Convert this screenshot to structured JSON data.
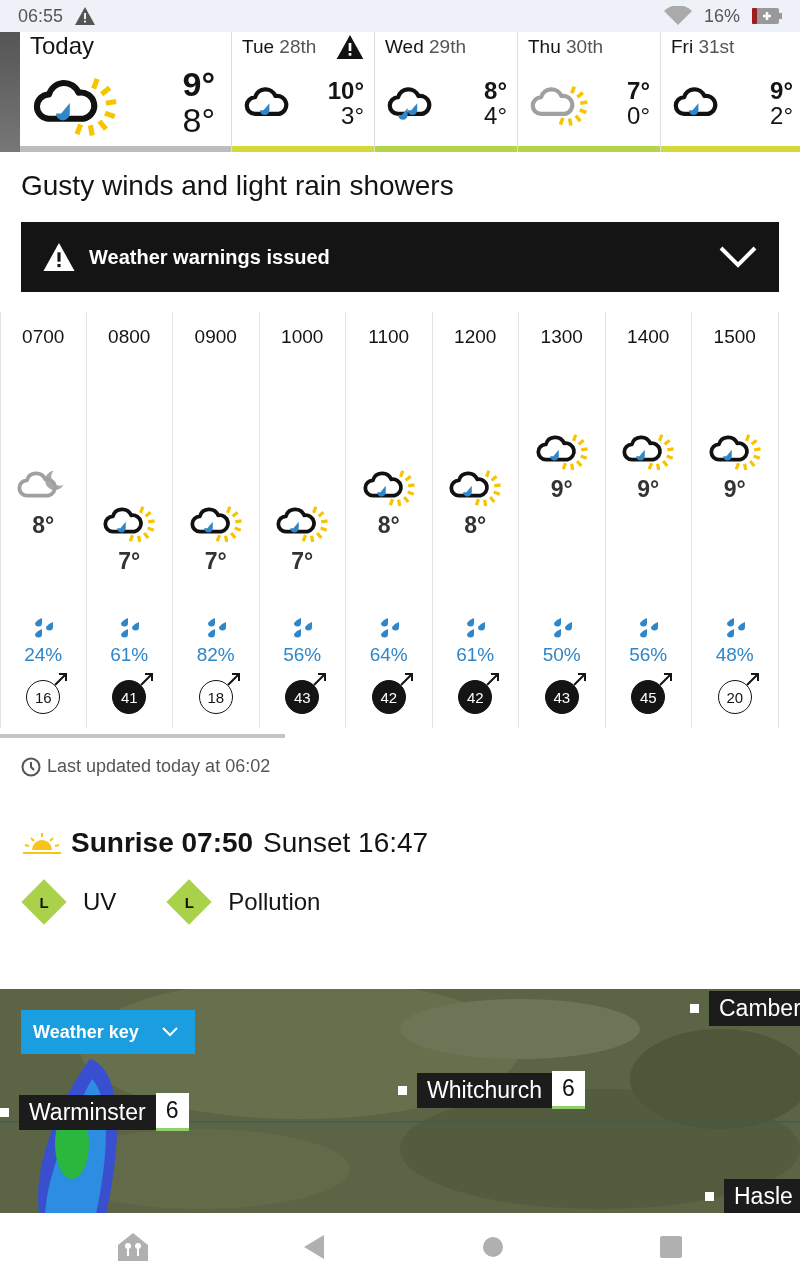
{
  "status_bar": {
    "time": "06:55",
    "battery": "16%"
  },
  "days": [
    {
      "label": "Today",
      "selected": true,
      "kind": "sun-shower",
      "high": "9°",
      "low": "8°",
      "warning": false,
      "color": "#bdbdbd"
    },
    {
      "day": "Tue",
      "date": "28th",
      "selected": false,
      "kind": "light-rain",
      "high": "10°",
      "low": "3°",
      "warning": true,
      "color": "#d4d93a"
    },
    {
      "day": "Wed",
      "date": "29th",
      "selected": false,
      "kind": "rain",
      "high": "8°",
      "low": "4°",
      "warning": false,
      "color": "#b5d44a"
    },
    {
      "day": "Thu",
      "date": "30th",
      "selected": false,
      "kind": "partly-cloudy",
      "high": "7°",
      "low": "0°",
      "warning": false,
      "color": "#b5d44a"
    },
    {
      "day": "Fri",
      "date": "31st",
      "selected": false,
      "kind": "light-rain",
      "high": "9°",
      "low": "2°",
      "warning": false,
      "color": "#d4d93a"
    }
  ],
  "summary": "Gusty winds and light rain showers",
  "warnings_bar": {
    "label": "Weather warnings issued",
    "expanded": false
  },
  "hours": [
    {
      "time": "0700",
      "kind": "cloudy-night",
      "temperature": "8°",
      "rain": "24%",
      "wind": "16",
      "strong": false
    },
    {
      "time": "0800",
      "kind": "sun-shower",
      "temperature": "7°",
      "rain": "61%",
      "wind": "41",
      "strong": true
    },
    {
      "time": "0900",
      "kind": "sun-shower",
      "temperature": "7°",
      "rain": "82%",
      "wind": "18",
      "strong": false
    },
    {
      "time": "1000",
      "kind": "sun-shower",
      "temperature": "7°",
      "rain": "56%",
      "wind": "43",
      "strong": true
    },
    {
      "time": "1100",
      "kind": "sun-shower",
      "temperature": "8°",
      "rain": "64%",
      "wind": "42",
      "strong": true
    },
    {
      "time": "1200",
      "kind": "sun-shower",
      "temperature": "8°",
      "rain": "61%",
      "wind": "42",
      "strong": true
    },
    {
      "time": "1300",
      "kind": "sun-shower",
      "temperature": "9°",
      "rain": "50%",
      "wind": "43",
      "strong": true
    },
    {
      "time": "1400",
      "kind": "sun-shower",
      "temperature": "9°",
      "rain": "56%",
      "wind": "45",
      "strong": true
    },
    {
      "time": "1500",
      "kind": "sun-shower",
      "temperature": "9°",
      "rain": "48%",
      "wind": "20",
      "strong": false
    }
  ],
  "last_updated": "Last updated today at 06:02",
  "sun": {
    "sunrise": "Sunrise 07:50",
    "sunset": "Sunset 16:47"
  },
  "indices": [
    {
      "rating": "L",
      "label": "UV"
    },
    {
      "rating": "L",
      "label": "Pollution"
    }
  ],
  "map": {
    "weather_key": "Weather key",
    "places": [
      {
        "name": "Camber"
      },
      {
        "name": "Whitchurch",
        "temp": "6"
      },
      {
        "name": "Warminster",
        "temp": "6"
      },
      {
        "name": "Hasle"
      }
    ]
  }
}
